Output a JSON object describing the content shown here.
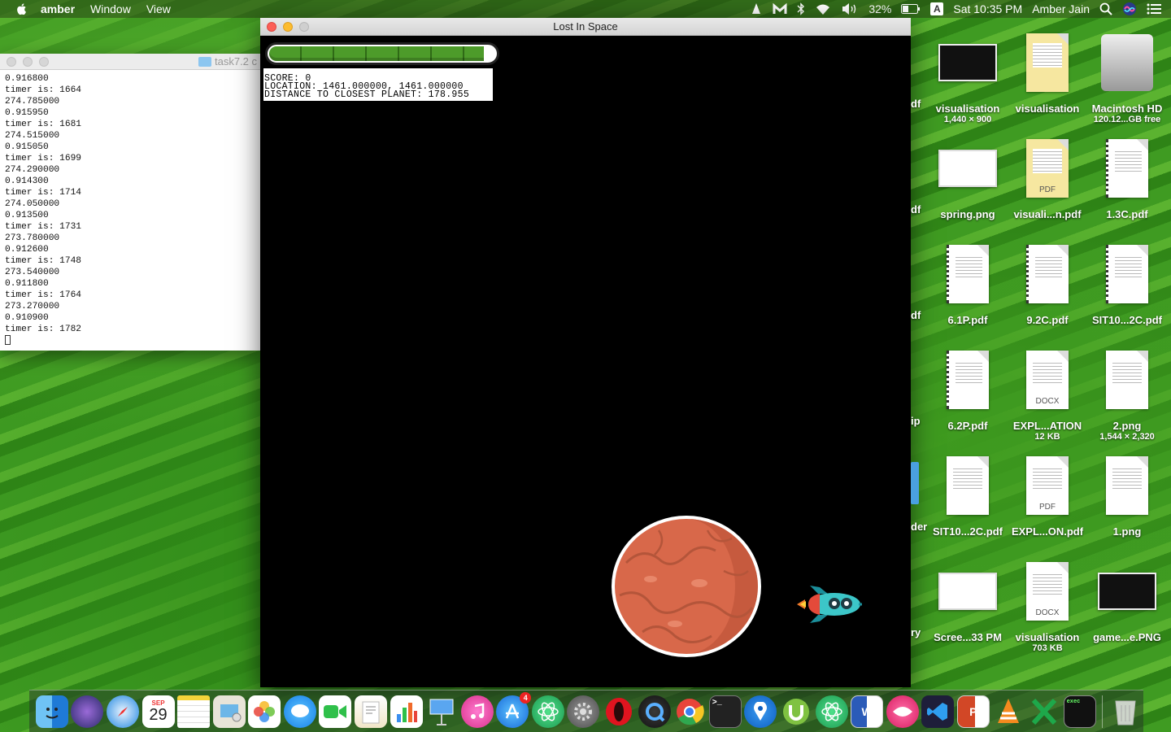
{
  "menubar": {
    "app_name": "amber",
    "menus": [
      "Window",
      "View"
    ],
    "battery": "32%",
    "input_source": "A",
    "clock": "Sat 10:35 PM",
    "user": "Amber Jain"
  },
  "terminal": {
    "title": "task7.2 c",
    "lines": [
      "0.916800",
      "timer is: 1664",
      "274.785000",
      "0.915950",
      "timer is: 1681",
      "274.515000",
      "0.915050",
      "timer is: 1699",
      "274.290000",
      "0.914300",
      "timer is: 1714",
      "274.050000",
      "0.913500",
      "timer is: 1731",
      "273.780000",
      "0.912600",
      "timer is: 1748",
      "273.540000",
      "0.911800",
      "timer is: 1764",
      "273.270000",
      "0.910900",
      "timer is: 1782"
    ]
  },
  "game": {
    "title": "Lost In Space",
    "health_fraction": 0.95,
    "hud": {
      "score": "SCORE: 0",
      "location": "LOCATION: 1461.000000, 1461.000000",
      "distance": "DISTANCE TO CLOSEST PLANET: 178.955"
    }
  },
  "desktop": {
    "left_cut_labels": [
      "df",
      "df",
      "df",
      "ip",
      "der",
      "ry"
    ],
    "icons": [
      {
        "label": "visualisation",
        "sub": "1,440 × 900",
        "kind": "shot-dark"
      },
      {
        "label": "visualisation",
        "sub": "",
        "kind": "yellow-doc"
      },
      {
        "label": "Macintosh HD",
        "sub": "120.12...GB free",
        "kind": "disk"
      },
      {
        "label": "spring.png",
        "sub": "",
        "kind": "shot"
      },
      {
        "label": "visuali...n.pdf",
        "sub": "",
        "kind": "yellow-pdf",
        "badge": "PDF"
      },
      {
        "label": "1.3C.pdf",
        "sub": "",
        "kind": "binder"
      },
      {
        "label": "6.1P.pdf",
        "sub": "",
        "kind": "binder"
      },
      {
        "label": "9.2C.pdf",
        "sub": "",
        "kind": "binder"
      },
      {
        "label": "SIT10...2C.pdf",
        "sub": "",
        "kind": "binder"
      },
      {
        "label": "6.2P.pdf",
        "sub": "",
        "kind": "binder"
      },
      {
        "label": "EXPL...ATION",
        "sub": "12 KB",
        "kind": "doc",
        "badge": "DOCX"
      },
      {
        "label": "2.png",
        "sub": "1,544 × 2,320",
        "kind": "doc"
      },
      {
        "label": "SIT10...2C.pdf",
        "sub": "",
        "kind": "doc"
      },
      {
        "label": "EXPL...ON.pdf",
        "sub": "",
        "kind": "doc",
        "badge": "PDF"
      },
      {
        "label": "1.png",
        "sub": "",
        "kind": "doc"
      },
      {
        "label": "Scree...33 PM",
        "sub": "",
        "kind": "shot"
      },
      {
        "label": "visualisation",
        "sub": "703 KB",
        "kind": "doc",
        "badge": "DOCX"
      },
      {
        "label": "game...e.PNG",
        "sub": "",
        "kind": "shot-dark"
      }
    ]
  },
  "dock": {
    "calendar_month": "SEP",
    "calendar_day": "29",
    "app_store_badge": "4"
  }
}
